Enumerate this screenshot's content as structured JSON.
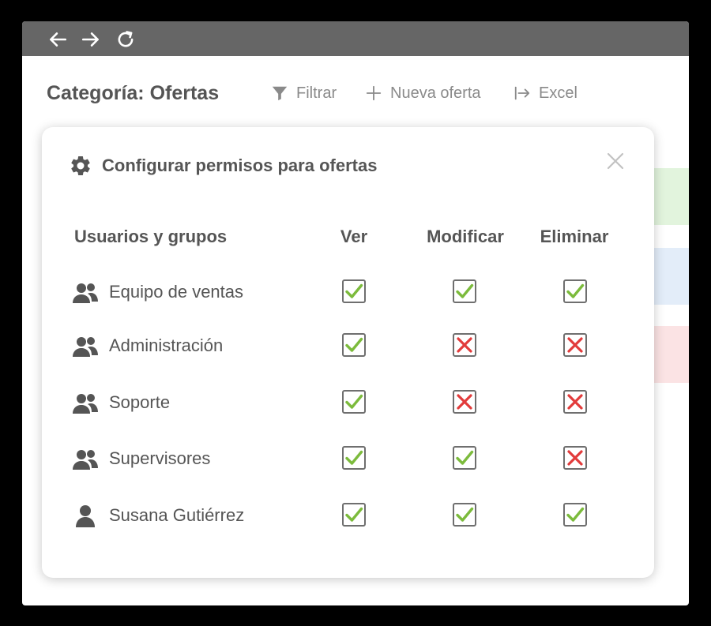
{
  "browser": {
    "icons": [
      "arrow-left-icon",
      "arrow-right-icon",
      "reload-icon"
    ]
  },
  "toolbar": {
    "title": "Categoría: Ofertas",
    "filter_label": "Filtrar",
    "new_label": "Nueva oferta",
    "excel_label": "Excel"
  },
  "modal": {
    "title": "Configurar permisos para ofertas",
    "columns": {
      "users": "Usuarios y grupos",
      "view": "Ver",
      "modify": "Modificar",
      "delete": "Eliminar"
    },
    "rows": [
      {
        "name": "Equipo de ventas",
        "type": "group",
        "view": true,
        "modify": true,
        "delete": true
      },
      {
        "name": "Administración",
        "type": "group",
        "view": true,
        "modify": false,
        "delete": false
      },
      {
        "name": "Soporte",
        "type": "group",
        "view": true,
        "modify": false,
        "delete": false
      },
      {
        "name": "Supervisores",
        "type": "group",
        "view": true,
        "modify": true,
        "delete": false
      },
      {
        "name": "Susana Gutiérrez",
        "type": "user",
        "view": true,
        "modify": true,
        "delete": true
      }
    ]
  },
  "colors": {
    "check": "#7cbb3c",
    "cross": "#e23b3b",
    "text": "#555555",
    "toolbar_text": "#8a8a8a",
    "browser_bar": "#666666"
  }
}
